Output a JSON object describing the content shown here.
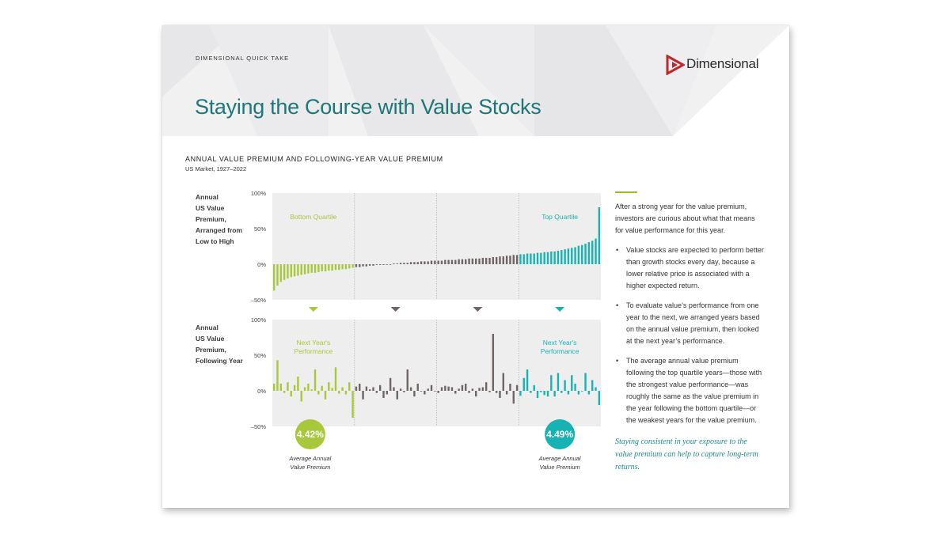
{
  "header": {
    "eyebrow": "DIMENSIONAL QUICK TAKE",
    "title": "Staying the Course with Value Stocks",
    "logo_text": "Dimensional"
  },
  "chart_data": {
    "type": "bar",
    "title": "ANNUAL VALUE PREMIUM AND FOLLOWING-YEAR VALUE PREMIUM",
    "subtitle": "US Market, 1927–2022",
    "panels": [
      {
        "ylabel": "Annual\nUS Value\nPremium,\nArranged from\nLow to High",
        "yticks": [
          "100%",
          "50%",
          "0%",
          "–50%"
        ],
        "ylim": [
          -50,
          100
        ],
        "annotations": [
          "Bottom Quartile",
          "Top Quartile"
        ],
        "values": [
          -37,
          -30,
          -25,
          -22,
          -20,
          -18,
          -17,
          -16,
          -15,
          -14,
          -13,
          -12,
          -12,
          -11,
          -10,
          -10,
          -9,
          -9,
          -8,
          -8,
          -7,
          -7,
          -6,
          -5,
          -4,
          -4,
          -3,
          -3,
          -2,
          -2,
          -1,
          -1,
          -1,
          0,
          0,
          1,
          1,
          2,
          2,
          2,
          3,
          3,
          3,
          4,
          4,
          4,
          5,
          5,
          5,
          5,
          6,
          6,
          6,
          6,
          7,
          7,
          7,
          8,
          8,
          8,
          8,
          9,
          9,
          9,
          10,
          10,
          11,
          11,
          12,
          12,
          13,
          13,
          14,
          14,
          15,
          15,
          15,
          16,
          16,
          17,
          17,
          18,
          18,
          19,
          20,
          21,
          22,
          23,
          24,
          26,
          27,
          29,
          31,
          33,
          36,
          80
        ]
      },
      {
        "ylabel": "Annual\nUS Value\nPremium,\nFollowing Year",
        "yticks": [
          "100%",
          "50%",
          "0%",
          "–50%"
        ],
        "ylim": [
          -50,
          100
        ],
        "annotations": [
          "Next Year's\nPerformance",
          "Next Year's\nPerformance"
        ],
        "values": [
          10,
          43,
          10,
          -3,
          12,
          -8,
          8,
          20,
          -15,
          5,
          10,
          2,
          30,
          -5,
          7,
          -12,
          12,
          4,
          33,
          -4,
          5,
          -5,
          12,
          -38,
          6,
          10,
          -12,
          6,
          2,
          5,
          -3,
          8,
          -10,
          -5,
          18,
          5,
          -12,
          3,
          -2,
          30,
          5,
          -8,
          10,
          0,
          -5,
          3,
          8,
          0,
          -3,
          5,
          7,
          6,
          5,
          -4,
          3,
          8,
          10,
          -3,
          3,
          -8,
          4,
          5,
          12,
          -2,
          80,
          -3,
          -10,
          25,
          -5,
          10,
          -18,
          8,
          -7,
          18,
          30,
          -3,
          8,
          -10,
          -2,
          -6,
          -8,
          22,
          -8,
          25,
          -3,
          15,
          -5,
          22,
          10,
          -5,
          0,
          25,
          -5,
          15,
          5,
          -20
        ]
      }
    ],
    "averages": [
      {
        "value": "4.42%",
        "label": "Average Annual\nValue Premium"
      },
      {
        "value": "4.49%",
        "label": "Average Annual\nValue Premium"
      }
    ],
    "colors": {
      "low": "#a8c73a",
      "mid": "#6e6463",
      "high": "#17b2b4",
      "panel_bg": "#efeeee"
    }
  },
  "commentary": {
    "intro": "After a strong year for the value premium, investors are curious about what that means for value performance for this year.",
    "bullets": [
      "Value stocks are expected to perform better than growth stocks every day, because a lower relative price is associated with a higher expected return.",
      "To evaluate value’s performance from one year to the next, we arranged years based on the annual value premium, then looked at the next year’s performance.",
      "The average annual value premium following the top quartile years—those with the strongest value performance—was roughly the same as the value premium in the year following the bottom quartile—or the weakest years for the value premium."
    ],
    "closing": "Staying consistent in your exposure to the value premium can help to capture long-term returns."
  }
}
